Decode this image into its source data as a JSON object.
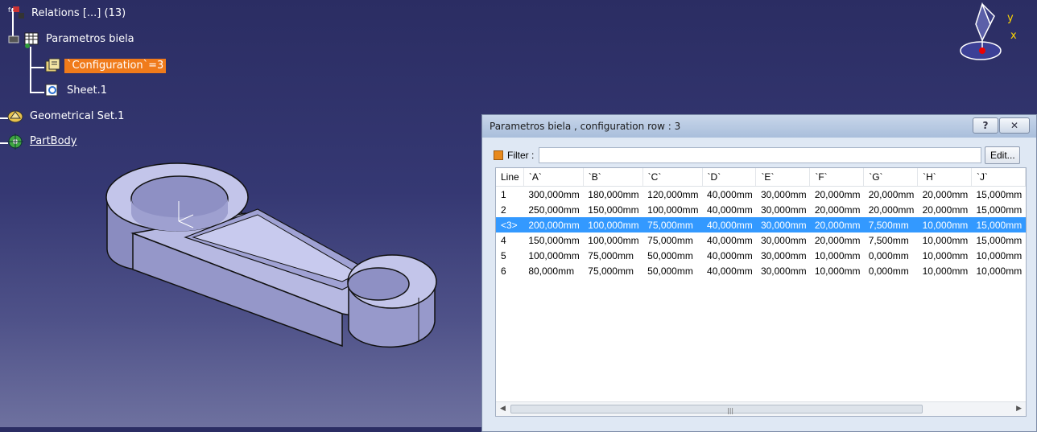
{
  "tree": {
    "relations": "Relations [...] (13)",
    "parametros": "Parametros biela",
    "configuration": "`Configuration`=3",
    "sheet": "Sheet.1",
    "geoset": "Geometrical Set.1",
    "partbody": "PartBody"
  },
  "compass": {
    "y": "y",
    "x": "x"
  },
  "dialog": {
    "title": "Parametros biela , configuration row : 3",
    "help": "?",
    "close": "✕",
    "filter_label": "Filter :",
    "edit_label": "Edit...",
    "columns": [
      "Line",
      "`A`",
      "`B`",
      "`C`",
      "`D`",
      "`E`",
      "`F`",
      "`G`",
      "`H`",
      "`J`"
    ],
    "rows": [
      [
        "1",
        "300,000mm",
        "180,000mm",
        "120,000mm",
        "40,000mm",
        "30,000mm",
        "20,000mm",
        "20,000mm",
        "20,000mm",
        "15,000mm"
      ],
      [
        "2",
        "250,000mm",
        "150,000mm",
        "100,000mm",
        "40,000mm",
        "30,000mm",
        "20,000mm",
        "20,000mm",
        "20,000mm",
        "15,000mm"
      ],
      [
        "<3>",
        "200,000mm",
        "100,000mm",
        "75,000mm",
        "40,000mm",
        "30,000mm",
        "20,000mm",
        "7,500mm",
        "10,000mm",
        "15,000mm"
      ],
      [
        "4",
        "150,000mm",
        "100,000mm",
        "75,000mm",
        "40,000mm",
        "30,000mm",
        "20,000mm",
        "7,500mm",
        "10,000mm",
        "15,000mm"
      ],
      [
        "5",
        "100,000mm",
        "75,000mm",
        "50,000mm",
        "40,000mm",
        "30,000mm",
        "10,000mm",
        "0,000mm",
        "10,000mm",
        "10,000mm"
      ],
      [
        "6",
        "80,000mm",
        "75,000mm",
        "50,000mm",
        "40,000mm",
        "30,000mm",
        "10,000mm",
        "0,000mm",
        "10,000mm",
        "10,000mm"
      ]
    ],
    "selected_row": 2,
    "scroll_grip": "|||"
  },
  "colors": {
    "selection": "#3399ff",
    "tree_highlight": "#f07b1b"
  }
}
